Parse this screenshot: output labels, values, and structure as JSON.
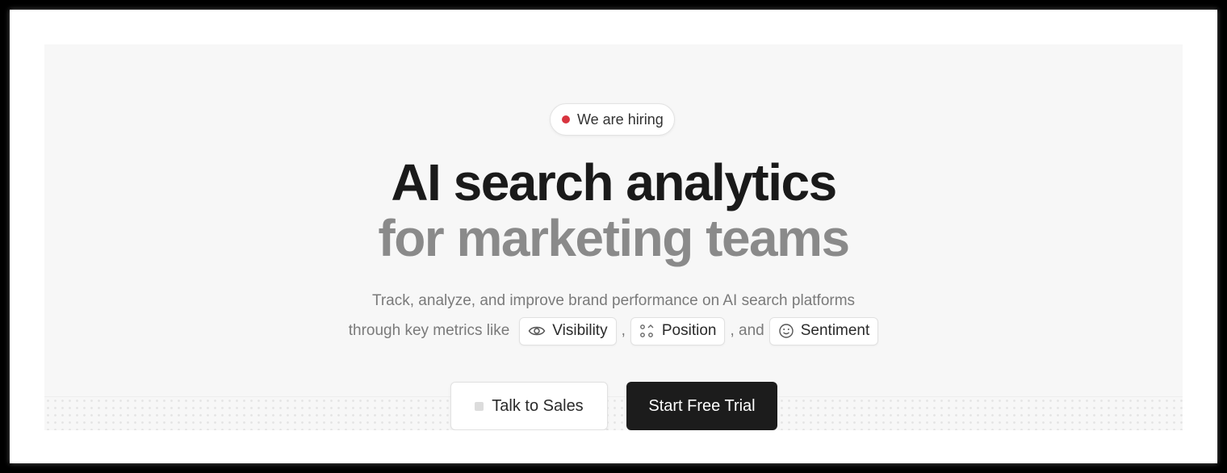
{
  "badge": {
    "label": "We are hiring",
    "dot_color": "#d8343f"
  },
  "headline": {
    "line1": "AI search analytics",
    "line2": "for marketing teams"
  },
  "subtitle": {
    "line1": "Track, analyze, and improve brand performance on AI search platforms",
    "prefix": "through key metrics like",
    "comma": ",",
    "and": ", and"
  },
  "metrics": [
    {
      "label": "Visibility",
      "icon": "eye-icon"
    },
    {
      "label": "Position",
      "icon": "position-icon"
    },
    {
      "label": "Sentiment",
      "icon": "smile-icon"
    }
  ],
  "buttons": {
    "talk_to_sales": "Talk to Sales",
    "start_free_trial": "Start Free Trial"
  },
  "colors": {
    "primary_button": "#1c1c1c",
    "headline_dark": "#1a1a1a",
    "headline_muted": "#8a8a8a"
  }
}
